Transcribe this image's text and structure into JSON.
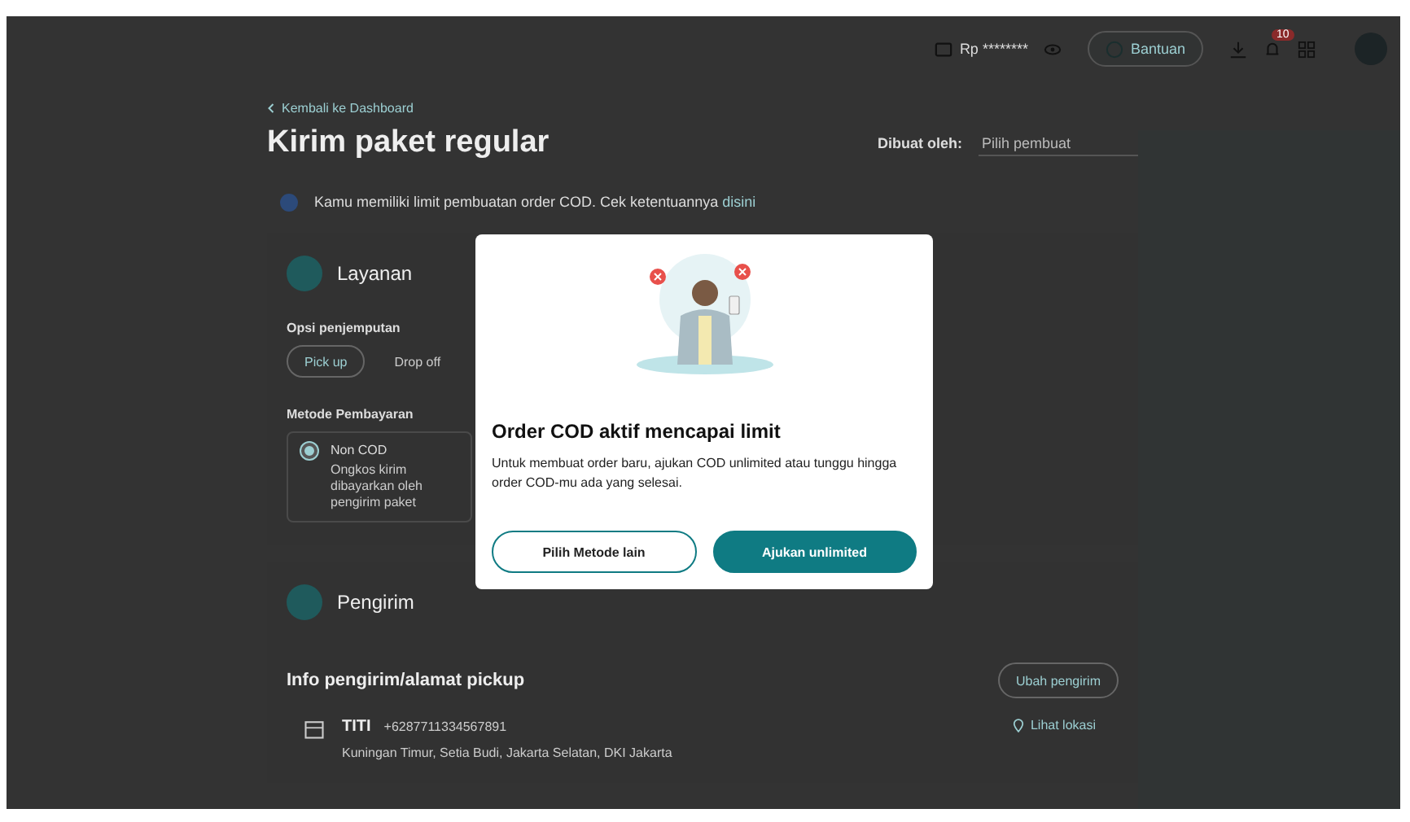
{
  "topbar": {
    "balance": "Rp ********",
    "help_button": "Bantuan",
    "notification_count": "10"
  },
  "back_link": "Kembali ke Dashboard",
  "title": "Kirim paket regular",
  "creator": {
    "label": "Dibuat oleh:",
    "placeholder": "Pilih pembuat"
  },
  "notice": {
    "text": "Kamu memiliki limit pembuatan order COD. Cek ketentuannya",
    "link": "disini"
  },
  "service_section": {
    "title": "Layanan",
    "pickup_label": "Opsi penjemputan",
    "pickup_options": [
      {
        "label": "Pick up",
        "selected": true
      },
      {
        "label": "Drop off",
        "selected": false
      }
    ],
    "payment_label": "Metode Pembayaran",
    "payment_options": [
      {
        "label": "Non COD",
        "description": "Ongkos kirim dibayarkan oleh pengirim paket",
        "selected": true
      }
    ]
  },
  "sender_section": {
    "title": "Pengirim",
    "info_title": "Info pengirim/alamat pickup",
    "change_button": "Ubah pengirim",
    "sender": {
      "name": "TITI",
      "phone": "+6287711334567891",
      "address": "Kuningan Timur, Setia Budi, Jakarta Selatan, DKI Jakarta",
      "location_link": "Lihat lokasi"
    }
  },
  "modal": {
    "title": "Order COD aktif mencapai limit",
    "message": "Untuk membuat order baru, ajukan COD unlimited atau tunggu hingga order COD-mu ada yang selesai.",
    "buttons": [
      {
        "label": "Pilih Metode lain",
        "kind": "secondary"
      },
      {
        "label": "Ajukan unlimited",
        "kind": "primary"
      }
    ]
  }
}
